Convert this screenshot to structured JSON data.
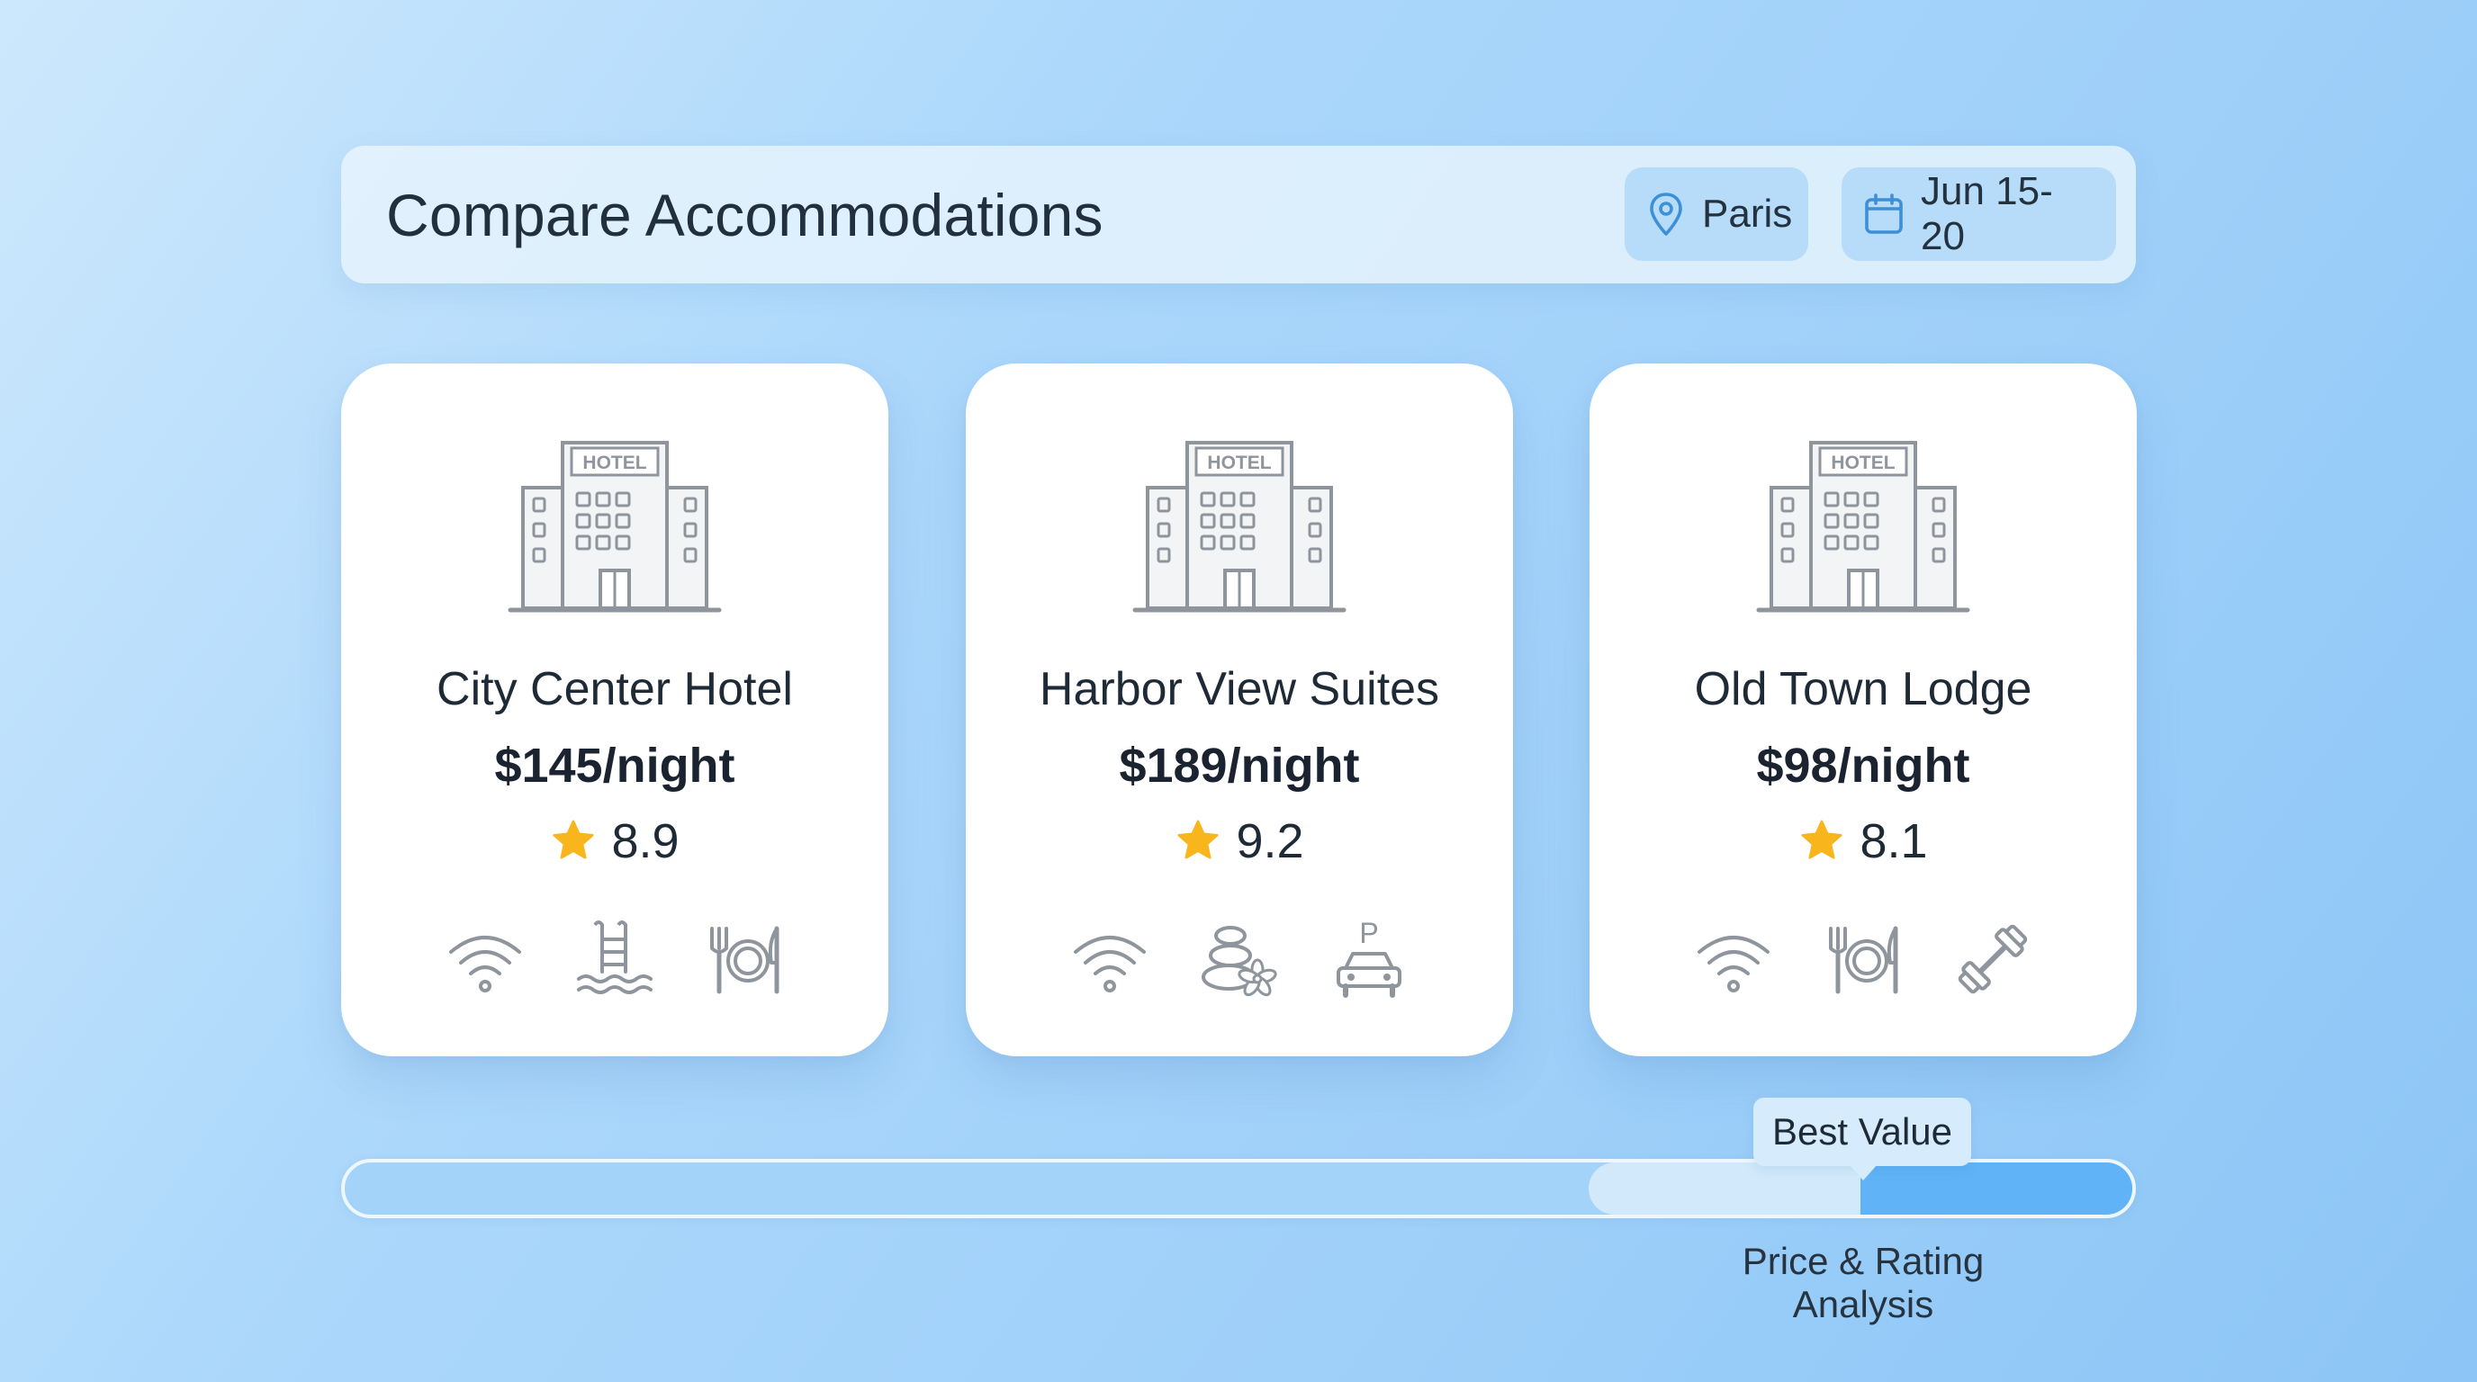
{
  "header": {
    "title": "Compare Accommodations",
    "location": "Paris",
    "location_icon": "map-pin-icon",
    "dates": "Jun 15-20",
    "dates_icon": "calendar-icon"
  },
  "hotel_icon_label": "HOTEL",
  "cards": [
    {
      "name": "City Center Hotel",
      "price": "$145/night",
      "rating": "8.9",
      "amenities": [
        "wifi-icon",
        "pool-icon",
        "restaurant-icon"
      ]
    },
    {
      "name": "Harbor View Suites",
      "price": "$189/night",
      "rating": "9.2",
      "amenities": [
        "wifi-icon",
        "spa-icon",
        "parking-icon"
      ]
    },
    {
      "name": "Old Town Lodge",
      "price": "$98/night",
      "rating": "8.1",
      "amenities": [
        "wifi-icon",
        "restaurant-icon",
        "gym-icon"
      ]
    }
  ],
  "analysis": {
    "tooltip": "Best Value",
    "label": "Price & Rating Analysis",
    "best_value_start_fraction": 0.696,
    "best_value_marker_fraction": 0.848
  },
  "colors": {
    "star": "#f8b51c",
    "icon_gray": "#8f959c",
    "accent_blue": "#4a9fe2",
    "chip_bg": "#b6dcfa"
  }
}
